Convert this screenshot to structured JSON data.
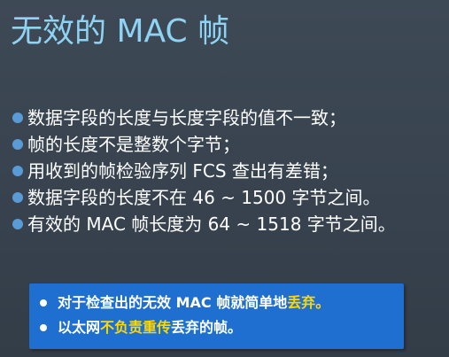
{
  "slide": {
    "title": "无效的 MAC 帧",
    "bullets": [
      "数据字段的长度与长度字段的值不一致；",
      "帧的长度不是整数个字节；",
      "用收到的帧检验序列 FCS 查出有差错；",
      "数据字段的长度不在 46 ~ 1500 字节之间。",
      "有效的 MAC 帧长度为 64 ~ 1518 字节之间。"
    ],
    "callout": {
      "line1": {
        "text": "对于检查出的无效 MAC 帧就简单地",
        "highlight": "丢弃。"
      },
      "line2": {
        "prefix": "以太网",
        "highlight": "不负责重传",
        "suffix": "丢弃的帧。"
      }
    },
    "colors": {
      "background": "#3a4552",
      "title": "#8fd3f4",
      "bullet_dot": "#5b9bd5",
      "callout_bg": "#1f6fd1",
      "highlight": "#ffd700"
    }
  }
}
